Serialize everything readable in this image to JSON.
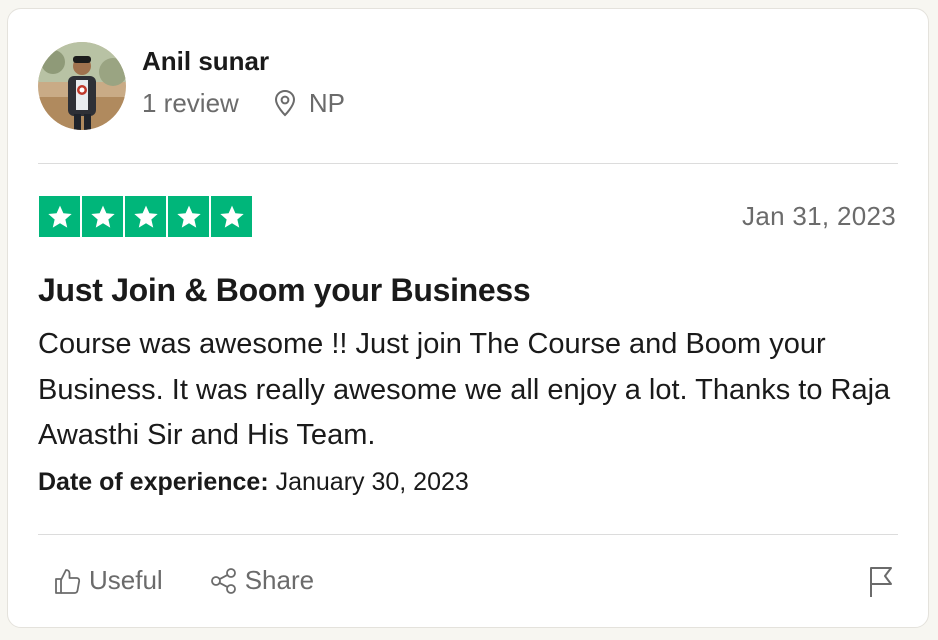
{
  "reviewer": {
    "name": "Anil sunar",
    "review_count": "1 review",
    "location": "NP"
  },
  "review": {
    "rating": 5,
    "date": "Jan 31, 2023",
    "title": "Just Join & Boom your Business",
    "body": "Course was awesome !! Just join The Course and Boom your Business. It was really awesome we all enjoy a lot. Thanks to Raja Awasthi Sir and His Team.",
    "experience_label": "Date of experience:",
    "experience_date": "January 30, 2023"
  },
  "actions": {
    "useful_label": "Useful",
    "share_label": "Share"
  },
  "icons": {
    "location": "location-pin-icon",
    "useful": "thumbs-up-icon",
    "share": "share-icon",
    "flag": "flag-icon",
    "star": "star-icon"
  },
  "colors": {
    "star_green": "#00b67a",
    "text_primary": "#1a1a1a",
    "text_secondary": "#6b6b6b"
  }
}
